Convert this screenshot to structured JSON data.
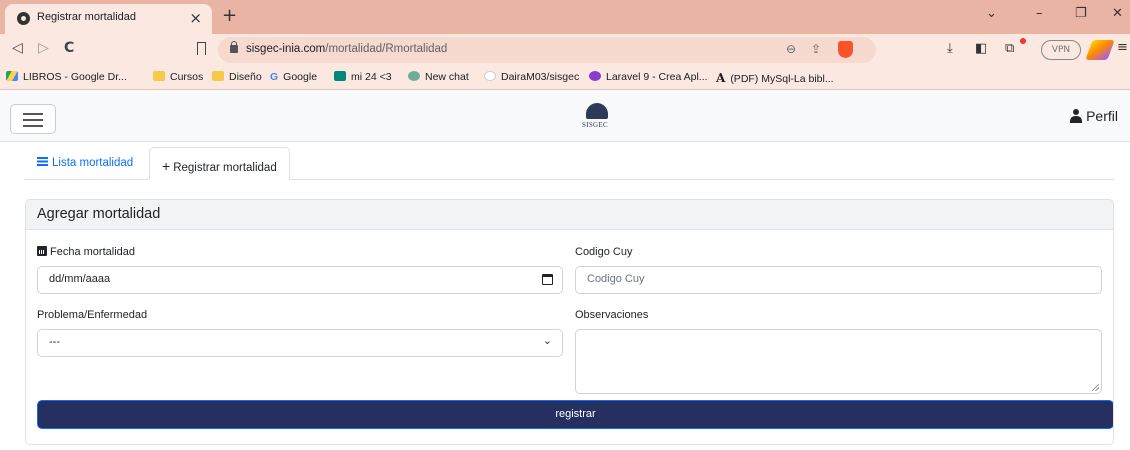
{
  "browser": {
    "tab_title": "Registrar mortalidad",
    "tab_close": "×",
    "new_tab": "+",
    "window_controls": {
      "dropdown": "⌄",
      "minimize": "–",
      "restore": "❐",
      "close": "✕"
    },
    "nav": {
      "back": "◁",
      "forward": "▷",
      "reload": "C"
    },
    "url_host": "sisgec-inia.com",
    "url_path": "/mortalidad/Rmortalidad",
    "vpn_label": "VPN",
    "bookmarks": [
      {
        "label": "LIBROS - Google Dr...",
        "icon": "google-drive-icon"
      },
      {
        "label": "Cursos",
        "icon": "folder-icon"
      },
      {
        "label": "Diseño",
        "icon": "folder-icon"
      },
      {
        "label": "Google",
        "icon": "google-icon"
      },
      {
        "label": "mi 24 <3",
        "icon": "google-meet-icon"
      },
      {
        "label": "New chat",
        "icon": "chatgpt-icon"
      },
      {
        "label": "DairaM03/sisgec",
        "icon": "github-icon"
      },
      {
        "label": "Laravel 9 - Crea Apl...",
        "icon": "laravel-icon"
      },
      {
        "label": "(PDF) MySql-La bibl...",
        "icon": "academia-icon"
      }
    ]
  },
  "header": {
    "logo_text": "SISGEC",
    "profile_label": "Perfil"
  },
  "tabs": {
    "list_label": "Lista mortalidad",
    "register_label": "Registrar mortalidad",
    "register_plus": "+"
  },
  "form": {
    "title": "Agregar mortalidad",
    "fecha_label": "Fecha mortalidad",
    "fecha_value": "dd/mm/aaaa",
    "codigo_label": "Codigo Cuy",
    "codigo_placeholder": "Codigo Cuy",
    "problema_label": "Problema/Enfermedad",
    "problema_value": "---",
    "observaciones_label": "Observaciones",
    "submit_label": "registrar"
  },
  "colors": {
    "tab_strip": "#e9b4a4",
    "toolbar": "#fbe8e1",
    "primary_button": "#253060",
    "link": "#0d6efd"
  }
}
